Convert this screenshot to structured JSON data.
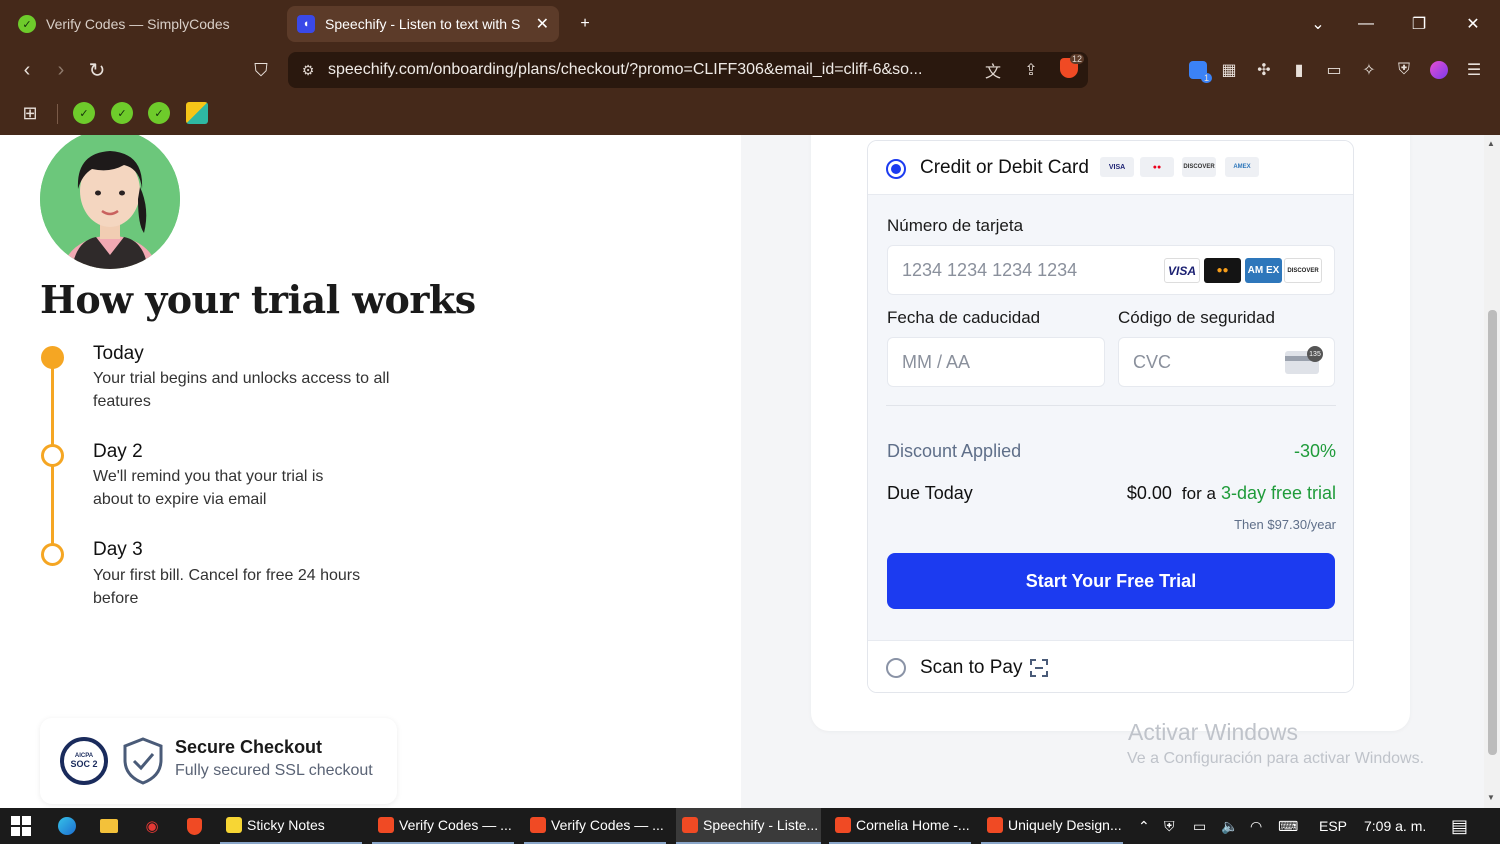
{
  "browser": {
    "tabs": [
      {
        "title": "Verify Codes — SimplyCodes",
        "active": false
      },
      {
        "title": "Speechify - Listen to text with S",
        "active": true
      }
    ],
    "new_tab": "+",
    "url": "speechify.com/onboarding/plans/checkout/?promo=CLIFF306&email_id=cliff-6&so...",
    "brave_badge": "12",
    "ext_badge": "1"
  },
  "trial": {
    "heading": "How your trial works",
    "steps": [
      {
        "title": "Today",
        "desc": "Your trial begins and unlocks access to all features"
      },
      {
        "title": "Day 2",
        "desc": "We'll remind you that your trial is about to expire via email"
      },
      {
        "title": "Day 3",
        "desc": "Your first bill. Cancel for free 24 hours before"
      }
    ],
    "secure": {
      "badge_top": "AICPA",
      "badge_main": "SOC 2",
      "title": "Secure Checkout",
      "subtitle": "Fully secured SSL checkout"
    }
  },
  "payment": {
    "card_option": "Credit or Debit Card",
    "mini_brands": [
      "VISA",
      "●●",
      "DISCOVER",
      "AMEX"
    ],
    "card_number_label": "Número de tarjeta",
    "card_number_placeholder": "1234 1234 1234 1234",
    "card_brands": [
      "VISA",
      "●●",
      "AM EX",
      "DISCOVER"
    ],
    "expiry_label": "Fecha de caducidad",
    "expiry_placeholder": "MM / AA",
    "cvc_label": "Código de seguridad",
    "cvc_placeholder": "CVC",
    "cvc_icon_text": "135",
    "discount_label": "Discount Applied",
    "discount_value": "-30%",
    "due_label": "Due Today",
    "due_amount": "$0.00",
    "due_for": "for a",
    "due_trial": "3-day free trial",
    "then": "Then $97.30/year",
    "cta": "Start Your Free Trial",
    "scan_option": "Scan to Pay"
  },
  "watermark": {
    "line1": "Activar Windows",
    "line2": "Ve a Configuración para activar Windows."
  },
  "taskbar": {
    "apps": [
      {
        "label": "Sticky Notes",
        "active": false
      },
      {
        "label": "Verify Codes — ...",
        "active": false
      },
      {
        "label": "Verify Codes — ...",
        "active": false
      },
      {
        "label": "Speechify - Liste...",
        "active": true
      },
      {
        "label": "Cornelia Home -...",
        "active": false
      },
      {
        "label": "Uniquely Design...",
        "active": false
      }
    ],
    "lang": "ESP",
    "time": "7:09 a. m."
  },
  "colors": {
    "accent": "#1c3bf0",
    "timeline": "#f5a623",
    "discount": "#1f9b3a",
    "chrome": "#45291a"
  }
}
